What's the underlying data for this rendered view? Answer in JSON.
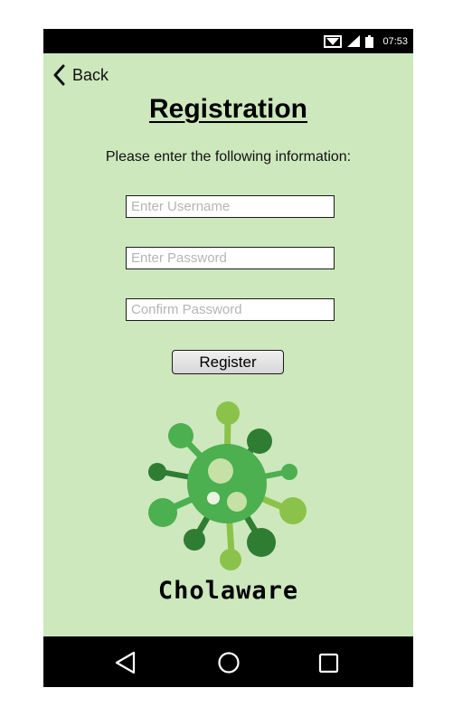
{
  "status_bar": {
    "time": "07:53",
    "icons": [
      "wifi-icon",
      "signal-icon",
      "battery-icon"
    ]
  },
  "header": {
    "back_label": "Back",
    "title": "Registration"
  },
  "form": {
    "instructions": "Please enter the following information:",
    "username_placeholder": "Enter Username",
    "password_placeholder": "Enter Password",
    "confirm_placeholder": "Confirm Password",
    "register_label": "Register"
  },
  "brand": {
    "name": "Cholaware",
    "colors": {
      "background": "#cde8bd",
      "logo_dark": "#2e7d32",
      "logo_mid": "#4caf50",
      "logo_light": "#8bc34a"
    }
  },
  "nav_bar": {
    "icons": [
      "nav-back-icon",
      "nav-home-icon",
      "nav-recents-icon"
    ]
  }
}
